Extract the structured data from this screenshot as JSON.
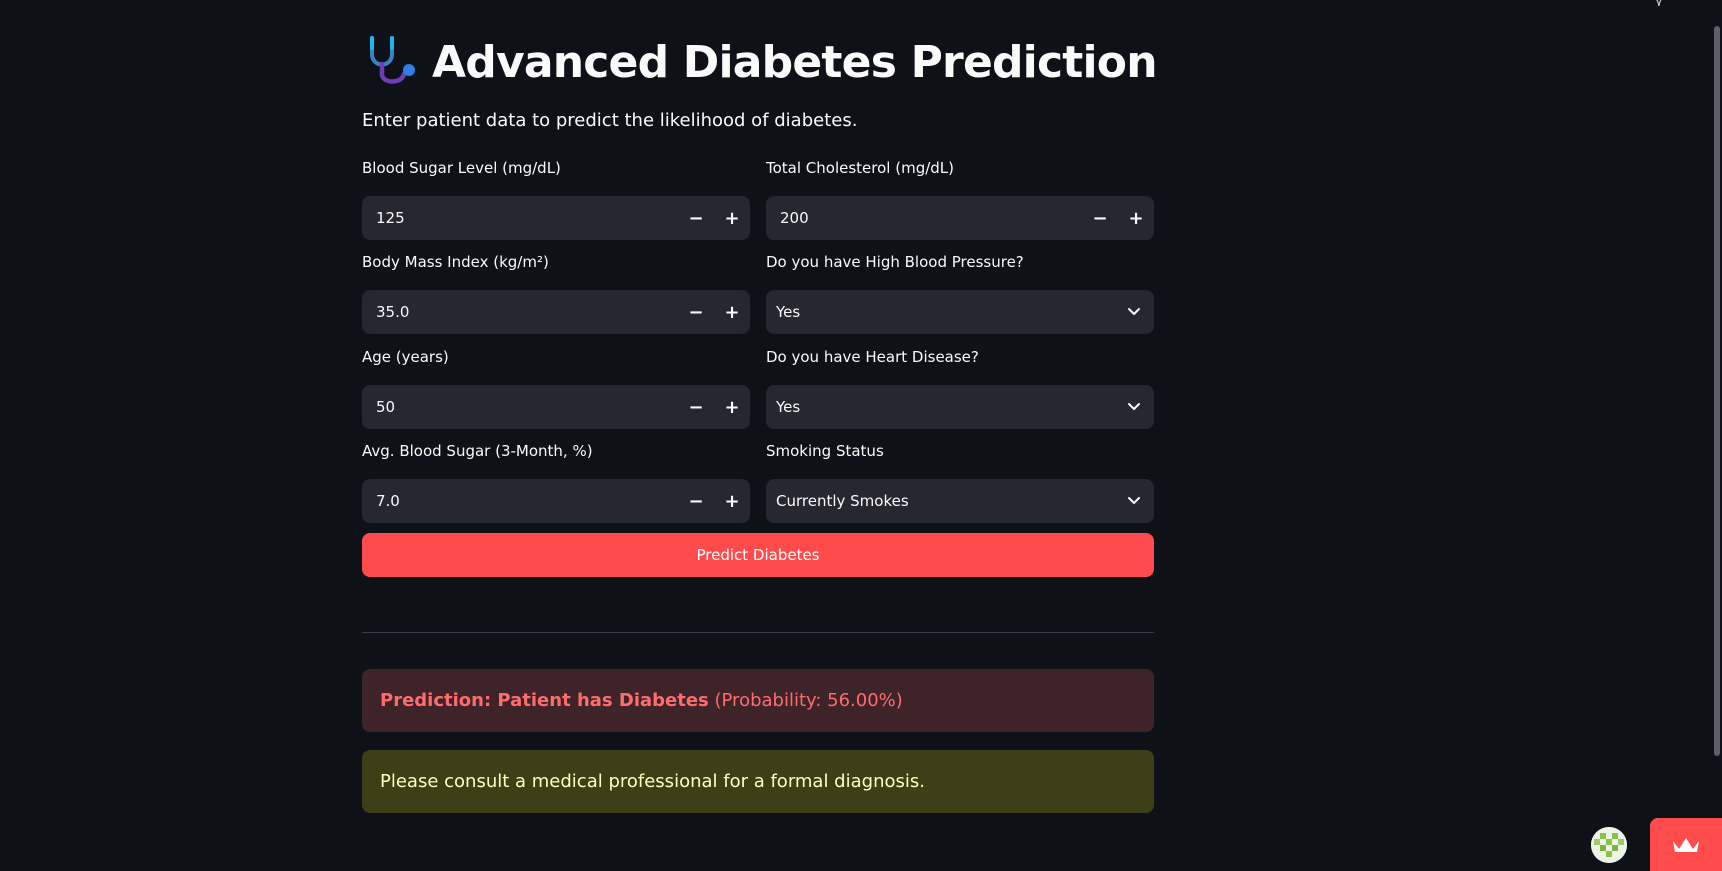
{
  "header": {
    "title": "Advanced Diabetes Prediction",
    "subtitle": "Enter patient data to predict the likelihood of diabetes.",
    "icon": "stethoscope-icon"
  },
  "form": {
    "blood_sugar": {
      "label": "Blood Sugar Level (mg/dL)",
      "value": "125"
    },
    "cholesterol": {
      "label": "Total Cholesterol (mg/dL)",
      "value": "200"
    },
    "bmi": {
      "label": "Body Mass Index (kg/m²)",
      "value": "35.0"
    },
    "high_bp": {
      "label": "Do you have High Blood Pressure?",
      "value": "Yes"
    },
    "age": {
      "label": "Age (years)",
      "value": "50"
    },
    "heart_disease": {
      "label": "Do you have Heart Disease?",
      "value": "Yes"
    },
    "avg_sugar": {
      "label": "Avg. Blood Sugar (3-Month, %)",
      "value": "7.0"
    },
    "smoking": {
      "label": "Smoking Status",
      "value": "Currently Smokes"
    },
    "stepper": {
      "minus": "−",
      "plus": "+"
    },
    "submit_label": "Predict Diabetes"
  },
  "result": {
    "prediction_bold": "Prediction: Patient has Diabetes",
    "probability": "(Probability: 56.00%)",
    "warning": "Please consult a medical professional for a formal diagnosis."
  },
  "colors": {
    "background": "#0e1117",
    "input_bg": "#262730",
    "primary": "#ff4b4b",
    "error_bg": "#3e2328",
    "error_text": "#ff6c6c",
    "warning_bg": "#3e3e17",
    "warning_text": "#ffffc2"
  }
}
